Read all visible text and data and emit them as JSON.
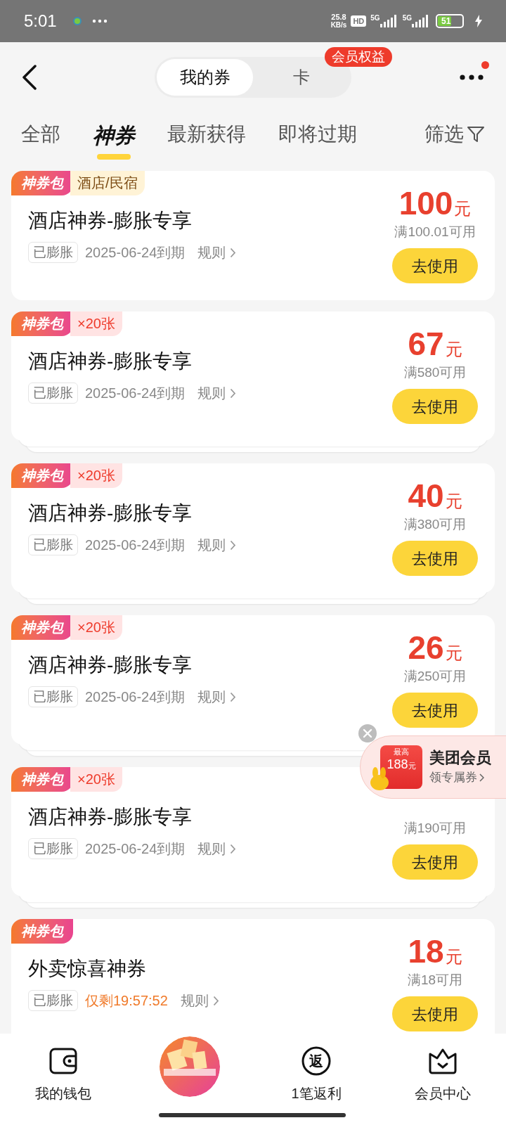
{
  "status_bar": {
    "time": "5:01",
    "net_speed": "25.8",
    "net_unit": "KB/s",
    "hd": "HD",
    "signal_1": "5G",
    "signal_2": "5G",
    "battery": "51"
  },
  "header": {
    "segments": [
      {
        "label": "我的券",
        "selected": true
      },
      {
        "label": "卡",
        "selected": false
      }
    ],
    "badge": "会员权益",
    "more_dot": true
  },
  "tabs": [
    {
      "label": "全部",
      "selected": false
    },
    {
      "label": "神券",
      "selected": true
    },
    {
      "label": "最新获得",
      "selected": false
    },
    {
      "label": "即将过期",
      "selected": false
    }
  ],
  "filter": "筛选",
  "coupons": [
    {
      "tags": [
        {
          "kind": "pack",
          "text": "神券包"
        },
        {
          "kind": "category",
          "text": "酒店/民宿"
        }
      ],
      "title": "酒店神券-膨胀专享",
      "badge": "已膨胀",
      "expiry": {
        "kind": "date",
        "text": "2025-06-24到期"
      },
      "rules": "规则",
      "amount": "100",
      "unit": "元",
      "condition": "满100.01可用",
      "button": "去使用",
      "stacked": false
    },
    {
      "tags": [
        {
          "kind": "pack",
          "text": "神券包"
        },
        {
          "kind": "count",
          "text": "×20张"
        }
      ],
      "title": "酒店神券-膨胀专享",
      "badge": "已膨胀",
      "expiry": {
        "kind": "date",
        "text": "2025-06-24到期"
      },
      "rules": "规则",
      "amount": "67",
      "unit": "元",
      "condition": "满580可用",
      "button": "去使用",
      "stacked": true
    },
    {
      "tags": [
        {
          "kind": "pack",
          "text": "神券包"
        },
        {
          "kind": "count",
          "text": "×20张"
        }
      ],
      "title": "酒店神券-膨胀专享",
      "badge": "已膨胀",
      "expiry": {
        "kind": "date",
        "text": "2025-06-24到期"
      },
      "rules": "规则",
      "amount": "40",
      "unit": "元",
      "condition": "满380可用",
      "button": "去使用",
      "stacked": true
    },
    {
      "tags": [
        {
          "kind": "pack",
          "text": "神券包"
        },
        {
          "kind": "count",
          "text": "×20张"
        }
      ],
      "title": "酒店神券-膨胀专享",
      "badge": "已膨胀",
      "expiry": {
        "kind": "date",
        "text": "2025-06-24到期"
      },
      "rules": "规则",
      "amount": "26",
      "unit": "元",
      "condition": "满250可用",
      "button": "去使用",
      "stacked": true
    },
    {
      "tags": [
        {
          "kind": "pack",
          "text": "神券包"
        },
        {
          "kind": "count",
          "text": "×20张"
        }
      ],
      "title": "酒店神券-膨胀专享",
      "badge": "已膨胀",
      "expiry": {
        "kind": "date",
        "text": "2025-06-24到期"
      },
      "rules": "规则",
      "condition": "满190可用",
      "button": "去使用",
      "stacked": true
    },
    {
      "tags": [
        {
          "kind": "pack",
          "text": "神券包"
        }
      ],
      "title": "外卖惊喜神券",
      "badge": "已膨胀",
      "expiry": {
        "kind": "countdown",
        "text": "仅剩19:57:52"
      },
      "rules": "规则",
      "amount": "18",
      "unit": "元",
      "condition": "满18可用",
      "button": "去使用",
      "stacked": false
    }
  ],
  "promo": {
    "label_top": "最高",
    "value": "188",
    "unit": "元",
    "title": "美团会员",
    "subtitle": "领专属券"
  },
  "bottom_nav": [
    {
      "kind": "wallet",
      "label": "我的钱包"
    },
    {
      "kind": "center"
    },
    {
      "kind": "rebate",
      "label": "1笔返利",
      "glyph": "返"
    },
    {
      "kind": "member",
      "label": "会员中心"
    }
  ]
}
